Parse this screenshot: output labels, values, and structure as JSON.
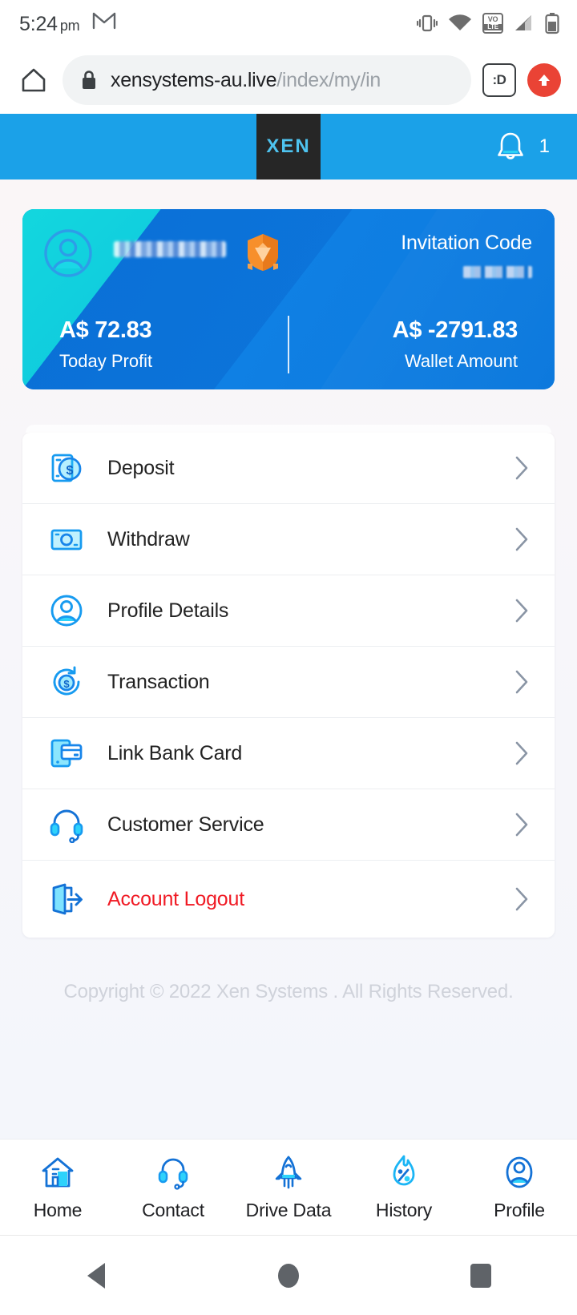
{
  "status_bar": {
    "time": "5:24",
    "ampm": "pm",
    "icons": [
      "gmail-icon",
      "vibrate-icon",
      "wifi-icon",
      "volte-icon",
      "signal-icon",
      "battery-icon"
    ],
    "volte_top": "VO",
    "volte_bottom": "LTE"
  },
  "browser": {
    "home_icon": "home-icon",
    "lock_icon": "lock-icon",
    "url_domain": "xensystems-au.live",
    "url_path": "/index/my/in",
    "tab_count": ":D",
    "menu_icon": "update-arrow-icon"
  },
  "app_header": {
    "logo_text": "XEN",
    "bell_icon": "bell-icon",
    "notification_count": "1",
    "background_color": "#1ba1e8",
    "logo_bg_color": "#262626",
    "logo_text_color": "#4ec3ef"
  },
  "profile_card": {
    "avatar_icon": "avatar-icon",
    "username": "",
    "badge_icon": "vip-shield-icon",
    "invitation_label": "Invitation Code",
    "invitation_code": "",
    "today_profit_value": "A$ 72.83",
    "today_profit_label": "Today Profit",
    "wallet_value": "A$ -2791.83",
    "wallet_label": "Wallet Amount",
    "gradient_start": "#13d7de",
    "gradient_end": "#0d79dd"
  },
  "menu": {
    "items": [
      {
        "label": "Deposit",
        "icon": "deposit-icon",
        "danger": false
      },
      {
        "label": "Withdraw",
        "icon": "withdraw-icon",
        "danger": false
      },
      {
        "label": "Profile Details",
        "icon": "profile-details-icon",
        "danger": false
      },
      {
        "label": "Transaction",
        "icon": "transaction-icon",
        "danger": false
      },
      {
        "label": "Link Bank Card",
        "icon": "bank-card-icon",
        "danger": false
      },
      {
        "label": "Customer Service",
        "icon": "headset-icon",
        "danger": false
      },
      {
        "label": "Account Logout",
        "icon": "logout-icon",
        "danger": true
      }
    ],
    "chevron_icon": "chevron-right-icon",
    "danger_color": "#f01a24"
  },
  "footer": {
    "copyright": "Copyright © 2022 Xen Systems . All Rights Reserved."
  },
  "tabbar": {
    "items": [
      {
        "label": "Home",
        "icon": "home-nav-icon"
      },
      {
        "label": "Contact",
        "icon": "headset-nav-icon"
      },
      {
        "label": "Drive Data",
        "icon": "rocket-nav-icon"
      },
      {
        "label": "History",
        "icon": "flame-percent-nav-icon"
      },
      {
        "label": "Profile",
        "icon": "profile-nav-icon"
      }
    ]
  },
  "android_nav": {
    "back": "back-triangle-icon",
    "home": "home-circle-icon",
    "recents": "recents-square-icon"
  }
}
